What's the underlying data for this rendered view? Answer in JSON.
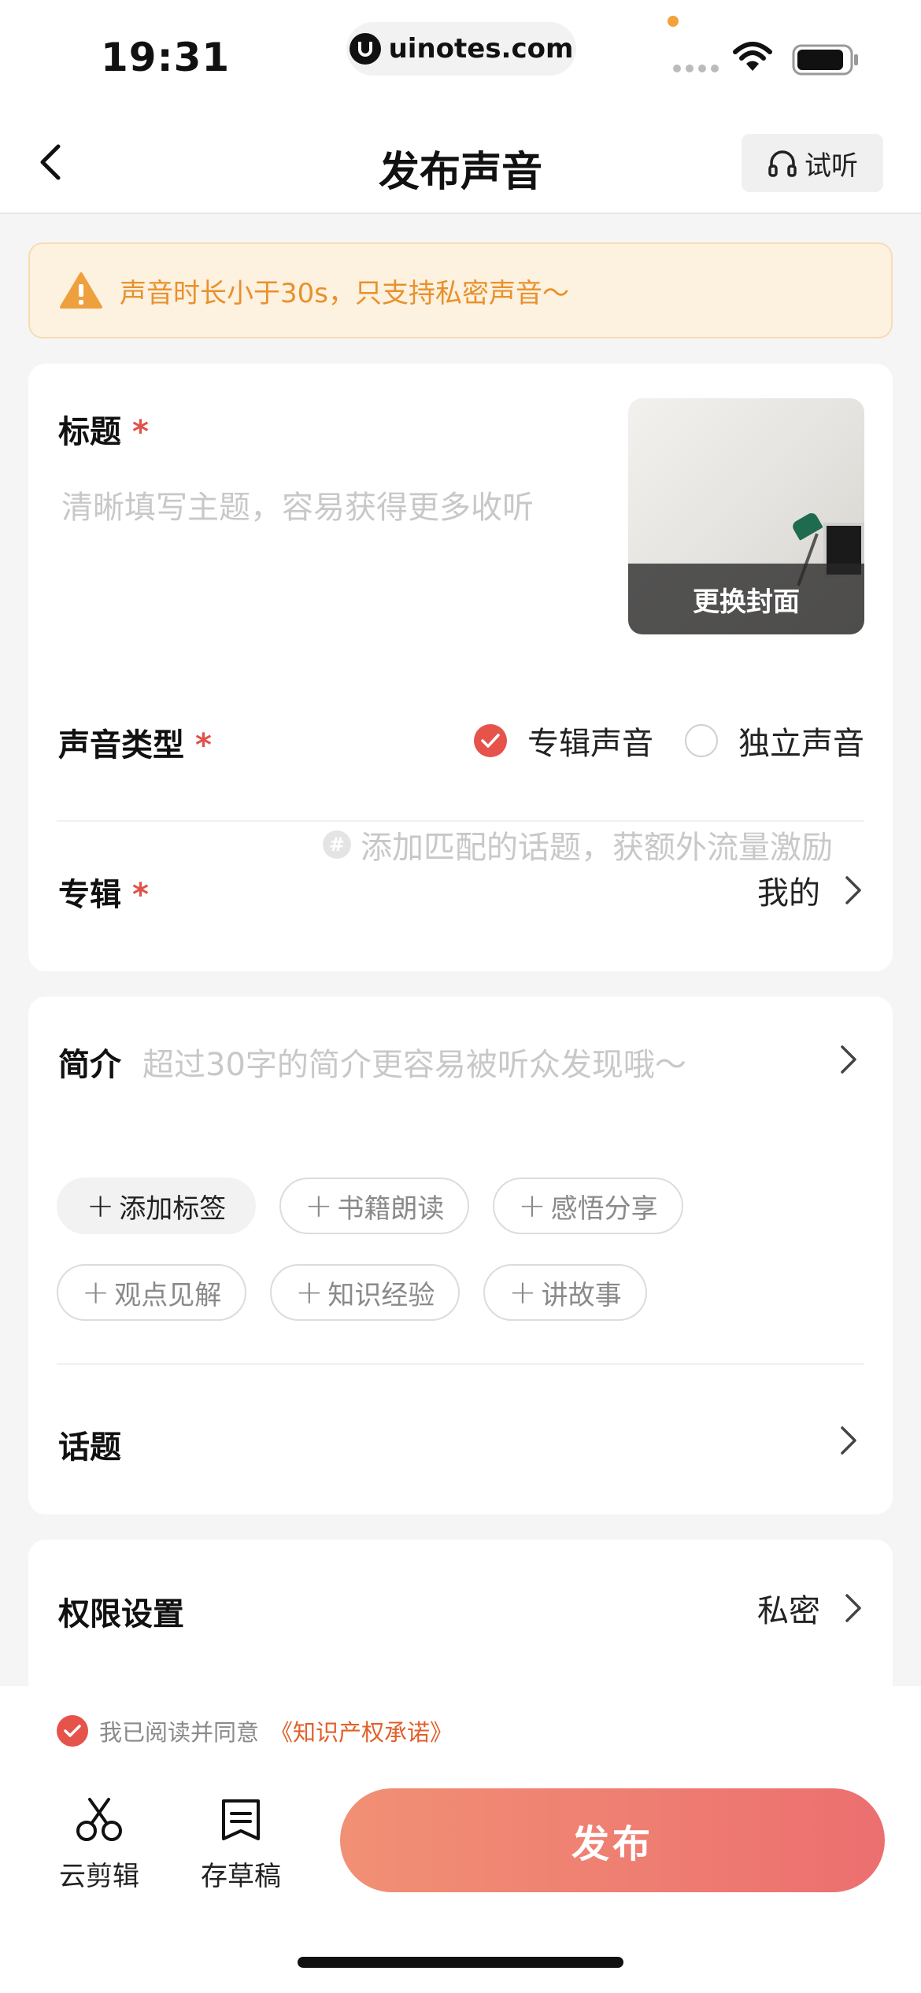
{
  "status_bar": {
    "time": "19:31",
    "url": "uinotes.com"
  },
  "nav": {
    "title": "发布声音",
    "listen_label": "试听"
  },
  "warning": {
    "text": "声音时长小于30s，只支持私密声音～",
    "color": "#e8912b"
  },
  "form": {
    "title_label": "标题",
    "required_mark": "*",
    "title_placeholder": "清晰填写主题，容易获得更多收听",
    "cover_label": "更换封面",
    "type_label": "声音类型",
    "type_options": [
      {
        "label": "专辑声音",
        "selected": true
      },
      {
        "label": "独立声音",
        "selected": false
      }
    ],
    "album_label": "专辑",
    "album_value": "我的",
    "intro_label": "简介",
    "intro_placeholder": "超过30字的简介更容易被听众发现哦～",
    "add_tag_label": "添加标签",
    "tags": [
      "书籍朗读",
      "感悟分享",
      "观点见解",
      "知识经验",
      "讲故事"
    ],
    "topic_label": "话题",
    "topic_placeholder": "添加匹配的话题，获额外流量激励",
    "permission_label": "权限设置",
    "permission_value": "私密"
  },
  "bottom": {
    "agree_text": "我已阅读并同意",
    "agree_link": "《知识产权承诺》",
    "tools": [
      {
        "label": "云剪辑",
        "icon": "scissors-icon"
      },
      {
        "label": "存草稿",
        "icon": "draft-icon"
      }
    ],
    "publish_label": "发布"
  },
  "colors": {
    "accent": "#e5534b",
    "publish_gradient_start": "#f19074",
    "publish_gradient_end": "#ec6f70"
  }
}
